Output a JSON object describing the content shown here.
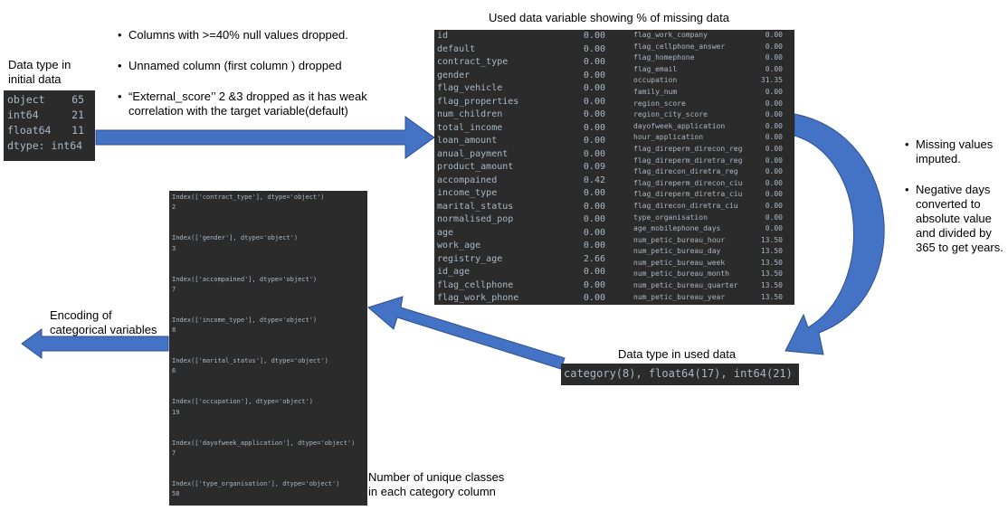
{
  "initial_block": {
    "title": "Data type in initial data",
    "rows": [
      {
        "name": "object",
        "value": "65"
      },
      {
        "name": "int64",
        "value": "21"
      },
      {
        "name": "float64",
        "value": "11"
      }
    ],
    "footer": "dtype: int64"
  },
  "notes_top": [
    "Columns with >=40% null values dropped.",
    "Unnamed column (first column ) dropped",
    "“External_score’’ 2 &3 dropped as it has weak correlation with the target variable(default)"
  ],
  "missing_block": {
    "title": "Used data variable showing  % of missing data",
    "left": [
      {
        "name": "id",
        "value": "0.00"
      },
      {
        "name": "default",
        "value": "0.00"
      },
      {
        "name": "contract_type",
        "value": "0.00"
      },
      {
        "name": "gender",
        "value": "0.00"
      },
      {
        "name": "flag_vehicle",
        "value": "0.00"
      },
      {
        "name": "flag_properties",
        "value": "0.00"
      },
      {
        "name": "num_children",
        "value": "0.00"
      },
      {
        "name": "total_income",
        "value": "0.00"
      },
      {
        "name": "loan_amount",
        "value": "0.00"
      },
      {
        "name": "anual_payment",
        "value": "0.00"
      },
      {
        "name": "product_amount",
        "value": "0.09"
      },
      {
        "name": "accompained",
        "value": "0.42"
      },
      {
        "name": "income_type",
        "value": "0.00"
      },
      {
        "name": "marital_status",
        "value": "0.00"
      },
      {
        "name": "normalised_pop",
        "value": "0.00"
      },
      {
        "name": "age",
        "value": "0.00"
      },
      {
        "name": "work_age",
        "value": "0.00"
      },
      {
        "name": "registry_age",
        "value": "2.66"
      },
      {
        "name": "id_age",
        "value": "0.00"
      },
      {
        "name": "flag_cellphone",
        "value": "0.00"
      },
      {
        "name": "flag_work_phone",
        "value": "0.00"
      }
    ],
    "right": [
      {
        "name": "flag_work_company",
        "value": "0.00"
      },
      {
        "name": "flag_cellphone_answer",
        "value": "0.00"
      },
      {
        "name": "flag_homephone",
        "value": "0.00"
      },
      {
        "name": "flag_email",
        "value": "0.00"
      },
      {
        "name": "occupation",
        "value": "31.35"
      },
      {
        "name": "family_num",
        "value": "0.00"
      },
      {
        "name": "region_score",
        "value": "0.00"
      },
      {
        "name": "region_city_score",
        "value": "0.00"
      },
      {
        "name": "dayofweek_application",
        "value": "0.00"
      },
      {
        "name": "hour_application",
        "value": "0.00"
      },
      {
        "name": "flag_direperm_direcon_reg",
        "value": "0.00"
      },
      {
        "name": "flag_direperm_diretra_reg",
        "value": "0.00"
      },
      {
        "name": "flag_direcon_diretra_reg",
        "value": "0.00"
      },
      {
        "name": "flag_direperm_direcon_ciu",
        "value": "0.00"
      },
      {
        "name": "flag_direperm_diretra_ciu",
        "value": "0.00"
      },
      {
        "name": "flag_direcon_diretra_ciu",
        "value": "0.00"
      },
      {
        "name": "type_organisation",
        "value": "0.00"
      },
      {
        "name": "age_mobilephone_days",
        "value": "0.00"
      },
      {
        "name": "num_petic_bureau_hour",
        "value": "13.50"
      },
      {
        "name": "num_petic_bureau_day",
        "value": "13.50"
      },
      {
        "name": "num_petic_bureau_week",
        "value": "13.50"
      },
      {
        "name": "num_petic_bureau_month",
        "value": "13.50"
      },
      {
        "name": "num_petic_bureau_quarter",
        "value": "13.50"
      },
      {
        "name": "num_petic_bureau_year",
        "value": "13.50"
      }
    ]
  },
  "notes_right": [
    "Missing values imputed.",
    " Negative days converted to absolute  value and  divided by 365 to get years."
  ],
  "used_block": {
    "title": "Data type in used data",
    "value": "category(8), float64(17), int64(21)"
  },
  "categories_block": {
    "entries": [
      {
        "index": "Index(['contract_type'], dtype='object')",
        "count": "2"
      },
      {
        "index": "Index(['gender'], dtype='object')",
        "count": "3"
      },
      {
        "index": "Index(['accompained'], dtype='object')",
        "count": "7"
      },
      {
        "index": "Index(['income_type'], dtype='object')",
        "count": "8"
      },
      {
        "index": "Index(['marital_status'], dtype='object')",
        "count": "6"
      },
      {
        "index": "Index(['occupation'], dtype='object')",
        "count": "19"
      },
      {
        "index": "Index(['dayofweek_application'], dtype='object')",
        "count": "7"
      },
      {
        "index": "Index(['type_organisation'], dtype='object')",
        "count": "58"
      }
    ],
    "caption": "Number of unique classes in each category column"
  },
  "encoding_label": "Encoding of categorical variables",
  "colors": {
    "arrow_fill": "#4472c4",
    "arrow_stroke": "#2f528f",
    "terminal_bg": "#2b2b2b",
    "terminal_text": "#a9b7c6"
  }
}
